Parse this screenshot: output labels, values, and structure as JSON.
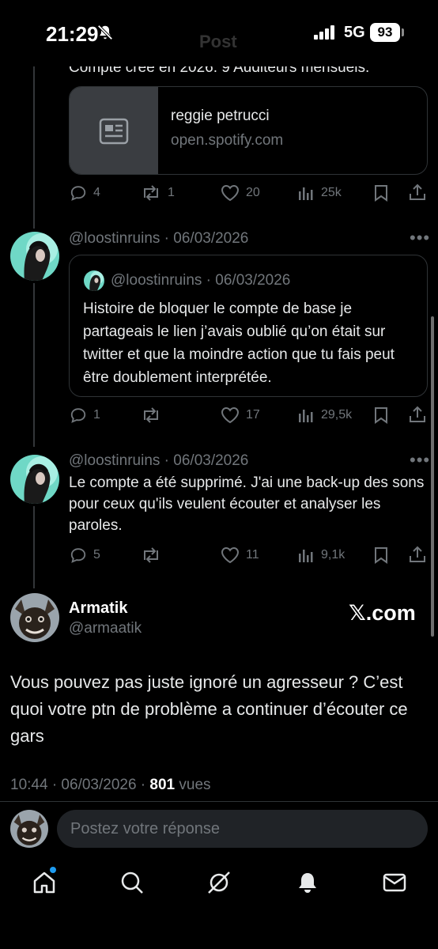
{
  "status_bar": {
    "time": "21:29",
    "network": "5G",
    "battery": "93"
  },
  "header": {
    "title": "Post"
  },
  "tweet1": {
    "truncated_text": "Compte créé en 2026. 9 Auditeurs mensuels.",
    "card": {
      "title": "reggie petrucci",
      "domain": "open.spotify.com"
    },
    "actions": {
      "replies": "4",
      "reposts": "1",
      "likes": "20",
      "views": "25k"
    }
  },
  "tweet2": {
    "meta": "@loostinruins · 06/03/2026",
    "quote": {
      "meta": "@loostinruins · 06/03/2026",
      "text": "Histoire de bloquer le compte de base je partageais le lien j’avais oublié qu’on était sur twitter et que la moindre action que tu fais peut être doublement interprétée."
    },
    "actions": {
      "replies": "1",
      "reposts": "",
      "likes": "17",
      "views": "29,5k"
    }
  },
  "tweet3": {
    "meta": "@loostinruins · 06/03/2026",
    "text": "Le compte a été supprimé. J'ai une back-up des sons pour ceux qu'ils veulent écouter et analyser les paroles.",
    "actions": {
      "replies": "5",
      "reposts": "",
      "likes": "11",
      "views": "9,1k"
    }
  },
  "main_post": {
    "name": "Armatik",
    "handle": "@armaatik",
    "source_badge": "𝕏.com",
    "text": "Vous pouvez pas juste ignoré un agresseur ? C’est quoi votre ptn de problème a continuer d’écouter ce gars",
    "timestamp": "10:44 · 06/03/2026 · ",
    "views_count": "801",
    "views_label": " vues"
  },
  "reply_box": {
    "placeholder": "Postez votre réponse"
  },
  "tab_bar": {
    "items": [
      "home-icon",
      "search-icon",
      "grok-icon",
      "notifications-icon",
      "messages-icon"
    ]
  },
  "colors": {
    "accent": "#1d9bf0",
    "muted": "#71767b",
    "background": "#000000"
  }
}
